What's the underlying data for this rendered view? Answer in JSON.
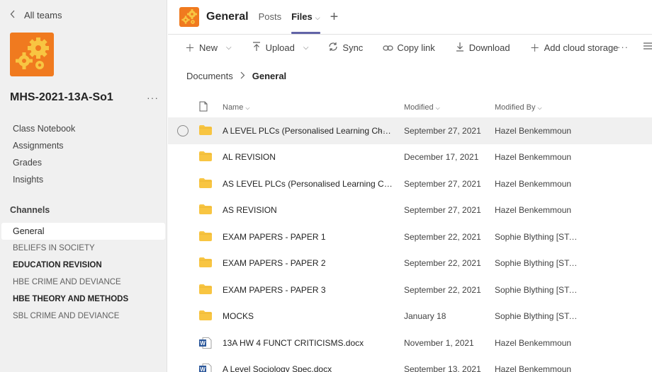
{
  "sidebar": {
    "back_label": "All teams",
    "team_name": "MHS-2021-13A-So1",
    "more": "···",
    "nav_items": [
      "Class Notebook",
      "Assignments",
      "Grades",
      "Insights"
    ],
    "channels_title": "Channels",
    "channels": [
      {
        "label": "General",
        "active": true,
        "bold": false
      },
      {
        "label": "BELIEFS IN SOCIETY",
        "active": false,
        "bold": false
      },
      {
        "label": "EDUCATION REVISION",
        "active": false,
        "bold": true
      },
      {
        "label": "HBE CRIME AND DEVIANCE",
        "active": false,
        "bold": false
      },
      {
        "label": "HBE THEORY AND METHODS",
        "active": false,
        "bold": true
      },
      {
        "label": "SBL CRIME AND DEVIANCE",
        "active": false,
        "bold": false
      }
    ]
  },
  "header": {
    "channel_title": "General",
    "tabs": [
      {
        "label": "Posts",
        "active": false
      },
      {
        "label": "Files",
        "active": true
      }
    ],
    "add_tab": "+"
  },
  "toolbar": {
    "new_label": "New",
    "upload_label": "Upload",
    "sync_label": "Sync",
    "copy_link_label": "Copy link",
    "download_label": "Download",
    "add_cloud_label": "Add cloud storage",
    "more": "···"
  },
  "breadcrumb": {
    "root": "Documents",
    "current": "General"
  },
  "table": {
    "columns": {
      "name": "Name",
      "modified": "Modified",
      "modified_by": "Modified By"
    },
    "rows": [
      {
        "type": "folder",
        "name": "A LEVEL PLCs (Personalised Learning Checklists)",
        "modified": "September 27, 2021",
        "by": "Hazel Benkemmoun"
      },
      {
        "type": "folder",
        "name": "AL REVISION",
        "modified": "December 17, 2021",
        "by": "Hazel Benkemmoun"
      },
      {
        "type": "folder",
        "name": "AS LEVEL PLCs (Personalised Learning Checklists)",
        "modified": "September 27, 2021",
        "by": "Hazel Benkemmoun"
      },
      {
        "type": "folder",
        "name": "AS REVISION",
        "modified": "September 27, 2021",
        "by": "Hazel Benkemmoun"
      },
      {
        "type": "folder",
        "name": "EXAM PAPERS - PAPER 1",
        "modified": "September 22, 2021",
        "by": "Sophie Blything [STAFF]"
      },
      {
        "type": "folder",
        "name": "EXAM PAPERS - PAPER 2",
        "modified": "September 22, 2021",
        "by": "Sophie Blything [STAFF]"
      },
      {
        "type": "folder",
        "name": "EXAM PAPERS - PAPER 3",
        "modified": "September 22, 2021",
        "by": "Sophie Blything [STAFF]"
      },
      {
        "type": "folder",
        "name": "MOCKS",
        "modified": "January 18",
        "by": "Sophie Blything [STAFF]"
      },
      {
        "type": "word",
        "name": "13A HW 4 FUNCT CRITICISMS.docx",
        "modified": "November 1, 2021",
        "by": "Hazel Benkemmoun"
      },
      {
        "type": "word",
        "name": "A Level Sociology Spec.docx",
        "modified": "September 13, 2021",
        "by": "Hazel Benkemmoun"
      }
    ]
  },
  "colors": {
    "accent": "#6264a7",
    "team_logo": "#f07a1f",
    "folder": "#f8c542",
    "word": "#2b579a"
  }
}
